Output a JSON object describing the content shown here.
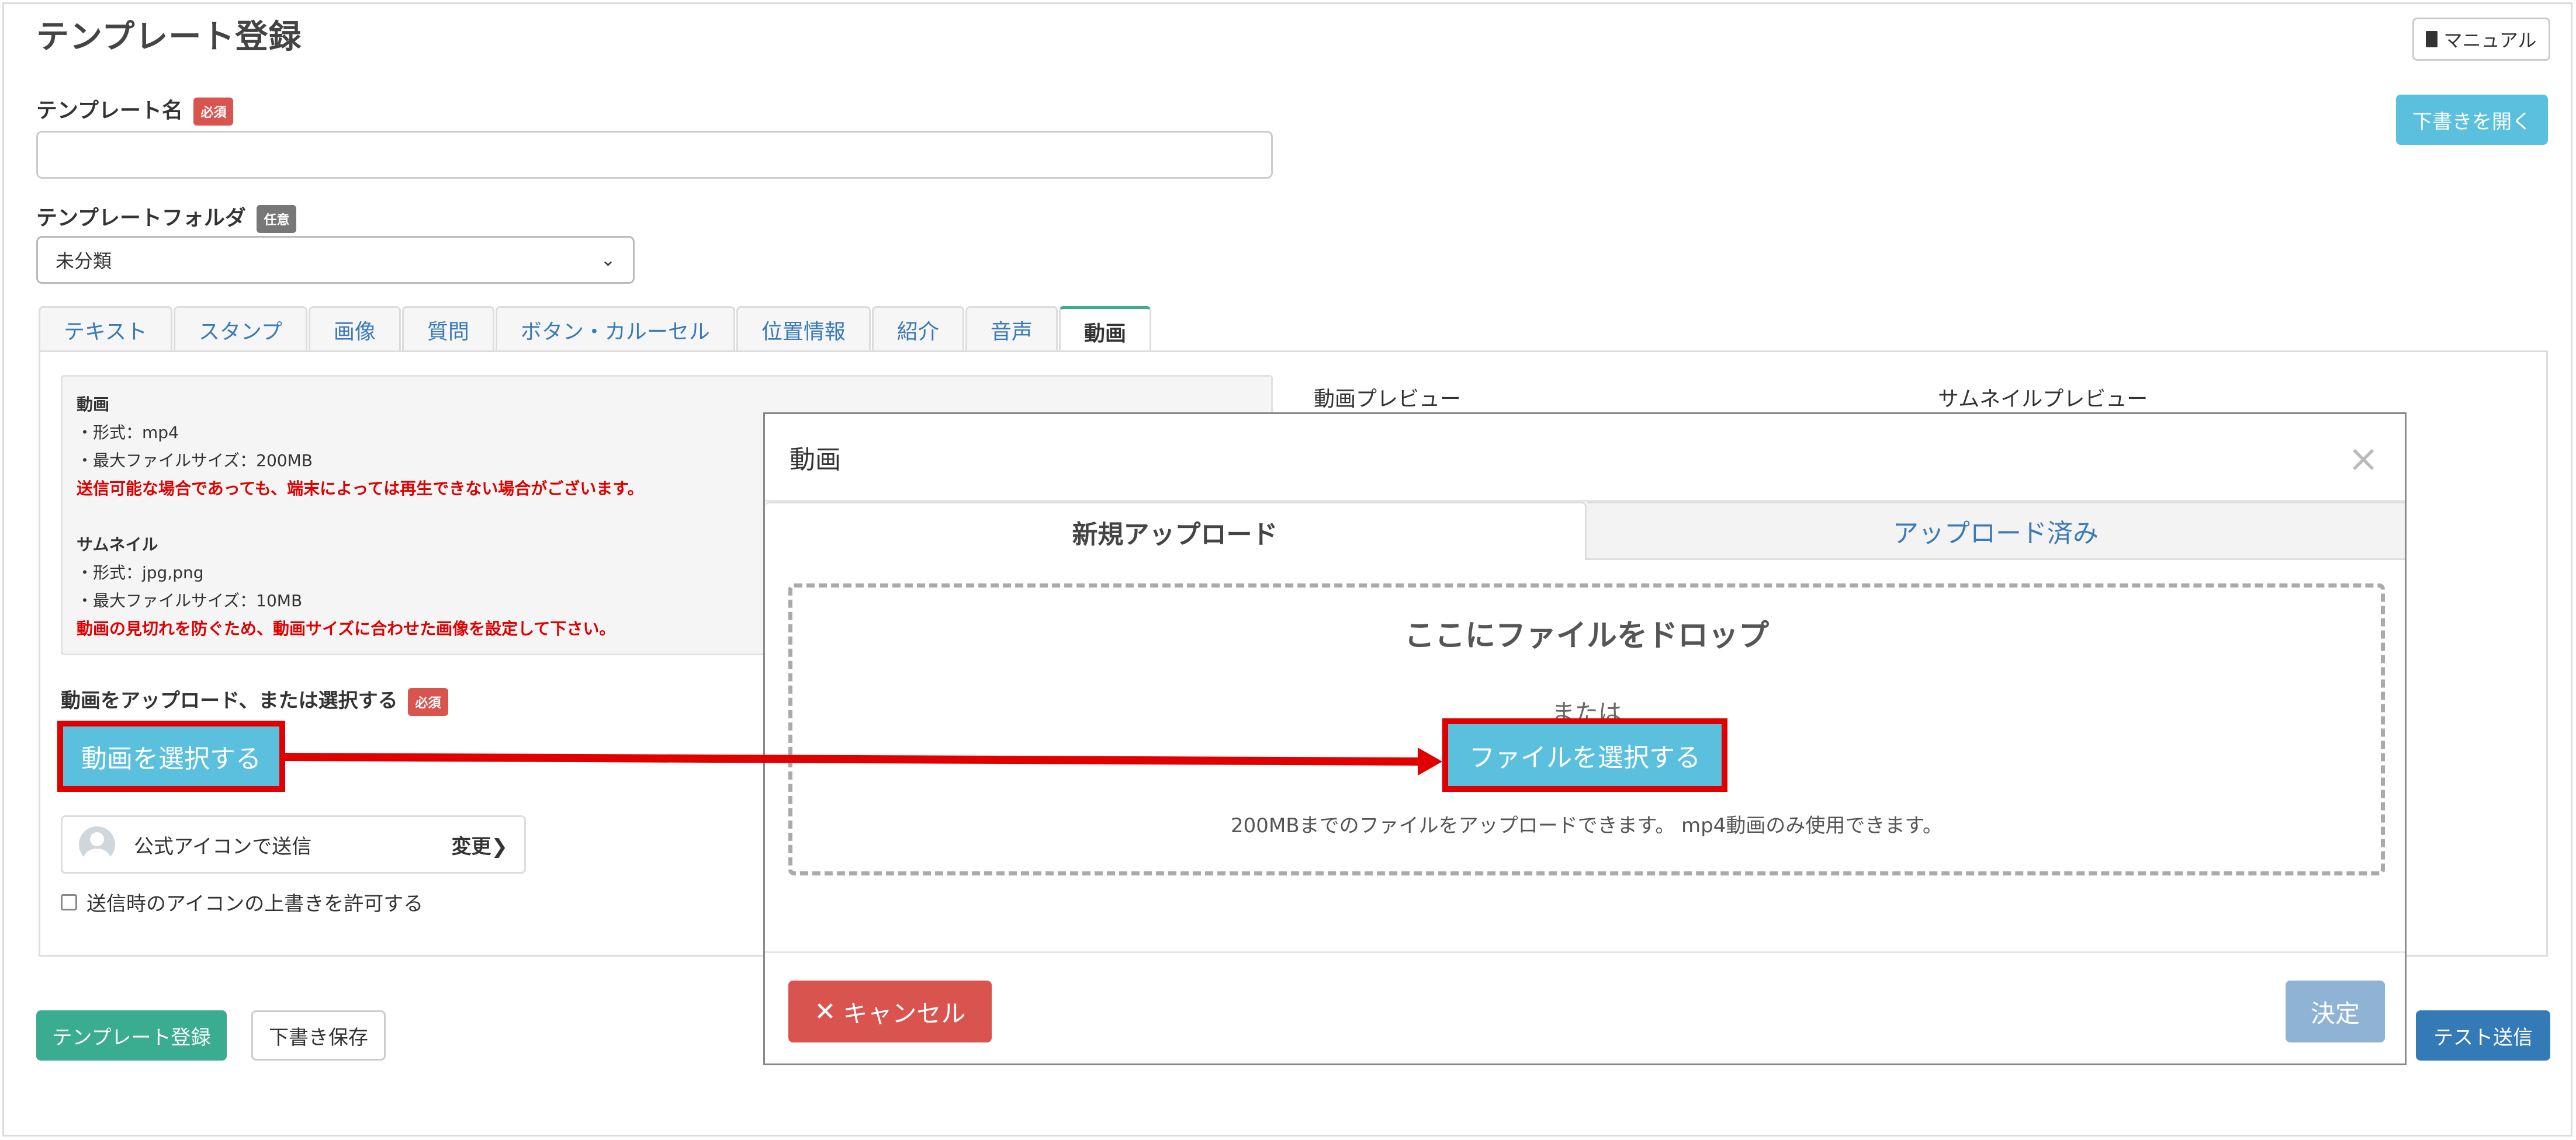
{
  "page": {
    "title": "テンプレート登録",
    "manual_button": "マニュアル",
    "open_draft_button": "下書きを開く"
  },
  "form": {
    "template_name_label": "テンプレート名",
    "required_badge": "必須",
    "optional_badge": "任意",
    "template_folder_label": "テンプレートフォルダ",
    "folder_selected": "未分類"
  },
  "tabs": [
    {
      "label": "テキスト"
    },
    {
      "label": "スタンプ"
    },
    {
      "label": "画像"
    },
    {
      "label": "質問"
    },
    {
      "label": "ボタン・カルーセル"
    },
    {
      "label": "位置情報"
    },
    {
      "label": "紹介"
    },
    {
      "label": "音声"
    },
    {
      "label": "動画",
      "active": true
    }
  ],
  "info": {
    "video_heading": "動画",
    "video_format": "・形式：mp4",
    "video_max_size": "・最大ファイルサイズ：200MB",
    "video_warning": "送信可能な場合であっても、端末によっては再生できない場合がございます。",
    "thumb_heading": "サムネイル",
    "thumb_format": "・形式：jpg,png",
    "thumb_max_size": "・最大ファイルサイズ：10MB",
    "thumb_warning": "動画の見切れを防ぐため、動画サイズに合わせた画像を設定して下さい。"
  },
  "preview": {
    "video_preview_label": "動画プレビュー",
    "thumb_preview_label": "サムネイルプレビュー"
  },
  "upload": {
    "label": "動画をアップロード、または選択する",
    "select_button": "動画を選択する"
  },
  "sender": {
    "name": "公式アイコンで送信",
    "change_link": "変更",
    "override_checkbox_label": "送信時のアイコンの上書きを許可する"
  },
  "footer": {
    "register_button": "テンプレート登録",
    "save_draft_button": "下書き保存",
    "test_send_button": "テスト送信"
  },
  "modal": {
    "title": "動画",
    "tab_new": "新規アップロード",
    "tab_uploaded": "アップロード済み",
    "drop_text": "ここにファイルをドロップ",
    "or_text": "または",
    "file_select_button": "ファイルを選択する",
    "note": "200MBまでのファイルをアップロードできます。 mp4動画のみ使用できます。",
    "cancel_button": "キャンセル",
    "confirm_button": "決定"
  },
  "colors": {
    "annotation_red": "#e00000",
    "info_blue": "#5bc0de",
    "success_green": "#3aac8f",
    "primary_blue": "#337ab7"
  }
}
